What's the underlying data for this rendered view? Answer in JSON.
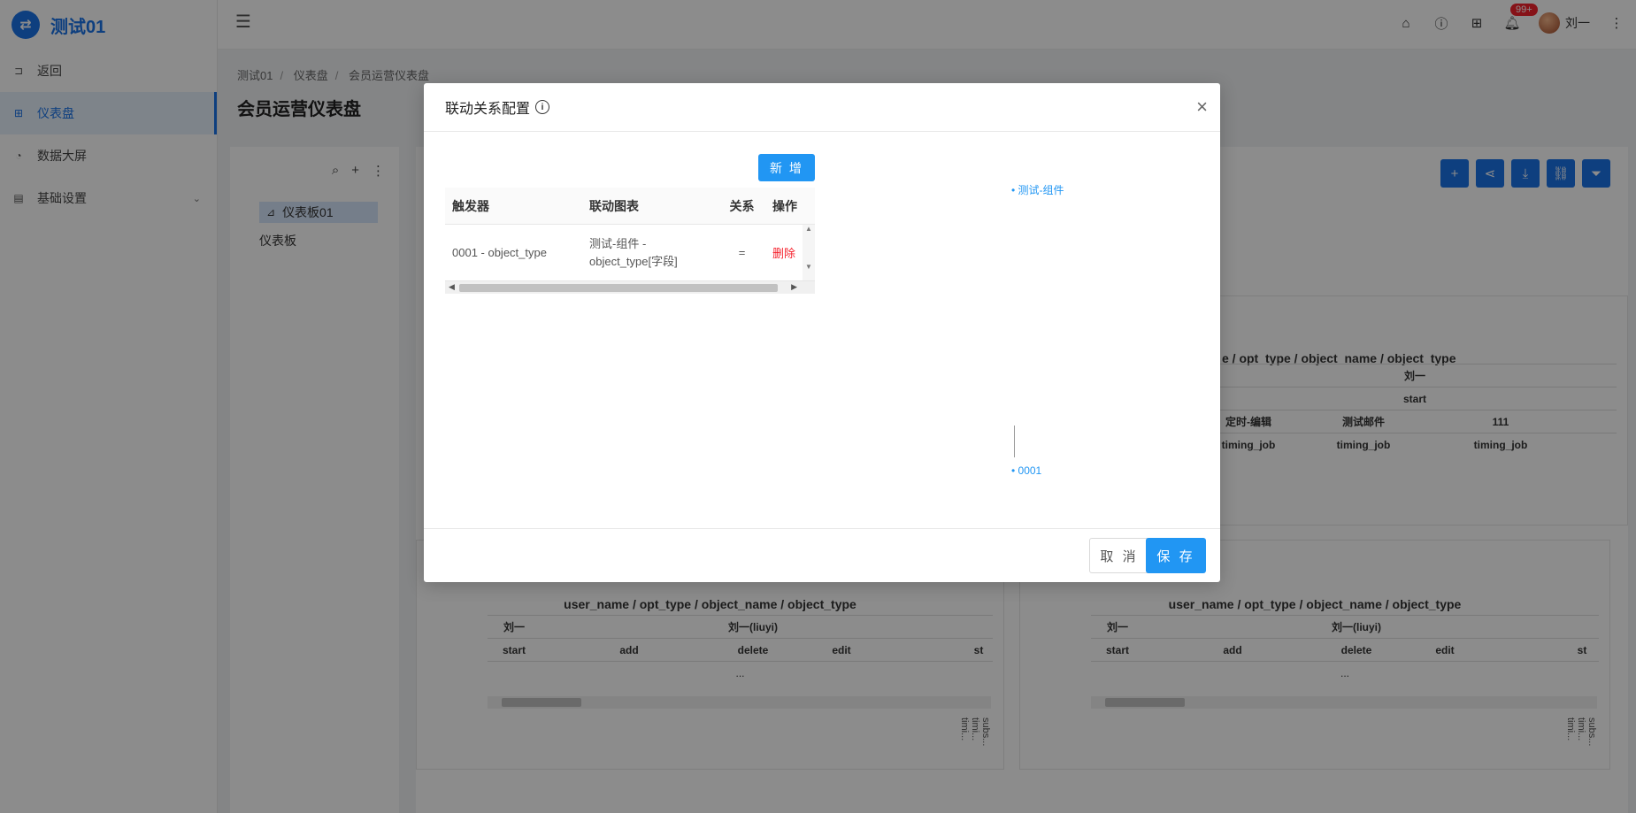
{
  "app": {
    "logo_glyph": "⇄",
    "title": "测试01"
  },
  "sidebar": {
    "items": [
      {
        "label": "返回",
        "icon": "back-icon"
      },
      {
        "label": "仪表盘",
        "icon": "dashboard-icon",
        "active": true
      },
      {
        "label": "数据大屏",
        "icon": "pie-icon"
      },
      {
        "label": "基础设置",
        "icon": "settings-icon",
        "has_children": true
      }
    ]
  },
  "header": {
    "notification_count": "99+",
    "user_name": "刘一"
  },
  "breadcrumb": [
    "测试01",
    "仪表盘",
    "会员运营仪表盘"
  ],
  "page_title": "会员运营仪表盘",
  "tree": {
    "items": [
      "仪表板01",
      "仪表板"
    ]
  },
  "background_charts": {
    "partial_title": "e / opt_type / object_name / object_type",
    "partial_rows": [
      [
        "刘一"
      ],
      [
        "start"
      ],
      [
        "定时-编辑",
        "测试邮件",
        "111"
      ],
      [
        "timing_job",
        "timing_job",
        "timing_job"
      ]
    ],
    "chart_title": "user_name / opt_type / object_name / object_type",
    "row1": "刘一",
    "row1b": "刘一(liuyi)",
    "row2": [
      "start",
      "add",
      "delete",
      "edit",
      "st"
    ],
    "ellipsis_cell": "...",
    "vertical_label": "subs... timi... timi..."
  },
  "modal": {
    "title": "联动关系配置",
    "add_button": "新 增",
    "columns": [
      "触发器",
      "联动图表",
      "关系",
      "操作"
    ],
    "rows": [
      {
        "trigger": "0001 - object_type",
        "linked_chart": "测试-组件 - object_type[字段]",
        "relation": "=",
        "action": "删除"
      }
    ],
    "graph_nodes": [
      "• 测试-组件",
      "• 0001"
    ],
    "cancel": "取 消",
    "save": "保 存"
  },
  "colors": {
    "primary": "#1a73e8",
    "button": "#2196f3",
    "danger": "#f5222d"
  }
}
